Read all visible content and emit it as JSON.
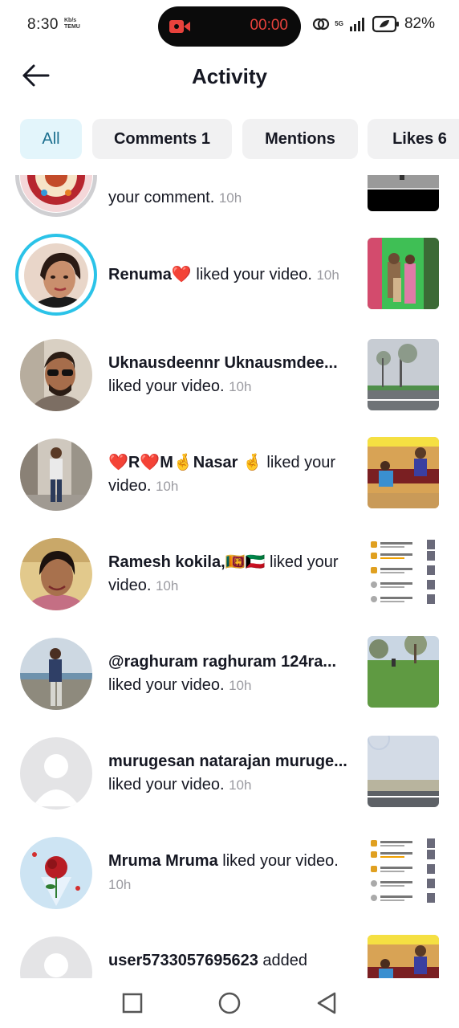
{
  "status_bar": {
    "time": "8:30",
    "small_label_1": "Kb/s",
    "small_label_2": "TEMU",
    "recording_time": "00:00",
    "network_label": "5G",
    "battery": "82%"
  },
  "header": {
    "title": "Activity"
  },
  "tabs": [
    {
      "label": "All"
    },
    {
      "label": "Comments 1"
    },
    {
      "label": "Mentions"
    },
    {
      "label": "Likes 6"
    }
  ],
  "activities": [
    {
      "user": "",
      "pre": "",
      "action": "your comment.",
      "time": "10h"
    },
    {
      "user": "Renuma",
      "emoji": "❤️",
      "action": " liked your video.",
      "time": "10h"
    },
    {
      "user": "Uknausdeennr Uknausmdee...",
      "action": "liked your video.",
      "time": "10h"
    },
    {
      "user": "❤️R❤️M🤞Nasar 🤞",
      "action": " liked your video.",
      "time": "10h"
    },
    {
      "user": "Ramesh kokila,🇱🇰🇰🇼",
      "action": " liked your video.",
      "time": "10h"
    },
    {
      "user": "@raghuram  raghuram 124ra...",
      "action": "liked your video.",
      "time": "10h"
    },
    {
      "user": "murugesan natarajan muruge...",
      "action": "  liked your video.",
      "time": "10h"
    },
    {
      "user": "Mruma Mruma",
      "action": " liked your video.",
      "time": "10h"
    },
    {
      "user": "user5733057695623",
      "action": " added",
      "time": ""
    }
  ],
  "colors": {
    "accent": "#2bc3e8",
    "tab_active_bg": "#e3f5fb",
    "tab_bg": "#f1f1f2",
    "record": "#e8423c"
  }
}
